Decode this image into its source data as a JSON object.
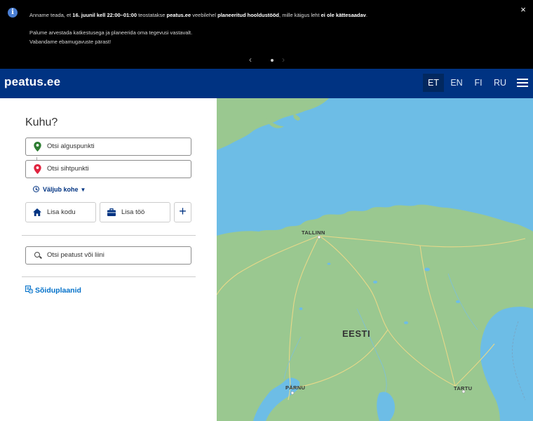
{
  "notice": {
    "line1_a": "Anname teada, et ",
    "line1_b": "16. juunil kell 22:00–01:00",
    "line1_c": " teostatakse ",
    "line1_d": "peatus.ee",
    "line1_e": " veebilehel ",
    "line1_f": "planeeritud hooldustööd",
    "line1_g": ", mille käigus leht ",
    "line1_h": "ei ole kättesaadav",
    "line1_i": ".",
    "line2": "Palume arvestada katkestusega ja planeerida oma tegevusi vastavalt.",
    "line3": "Vabandame ebamugavuste pärast!",
    "close_icon": "×",
    "prev_icon": "‹",
    "next_icon": "›"
  },
  "header": {
    "logo": "peatus.ee",
    "languages": [
      "ET",
      "EN",
      "FI",
      "RU"
    ],
    "active_language": "ET"
  },
  "sidebar": {
    "title": "Kuhu?",
    "origin_placeholder": "Otsi alguspunkti",
    "destination_placeholder": "Otsi sihtpunkti",
    "depart_label": "Väljub kohe",
    "home_label": "Lisa kodu",
    "work_label": "Lisa töö",
    "add_label": "+",
    "stop_search_placeholder": "Otsi peatust või liini",
    "timetables_label": "Sõiduplaanid"
  },
  "map": {
    "labels": [
      "TALLINN",
      "EESTI",
      "PÄRNU",
      "TARTU"
    ]
  },
  "colors": {
    "header_bg": "#003382",
    "accent": "#0070c9",
    "origin_pin": "#2e7d32",
    "destination_pin": "#e0243f",
    "sea": "#6dbde6",
    "land": "#9ac890"
  }
}
